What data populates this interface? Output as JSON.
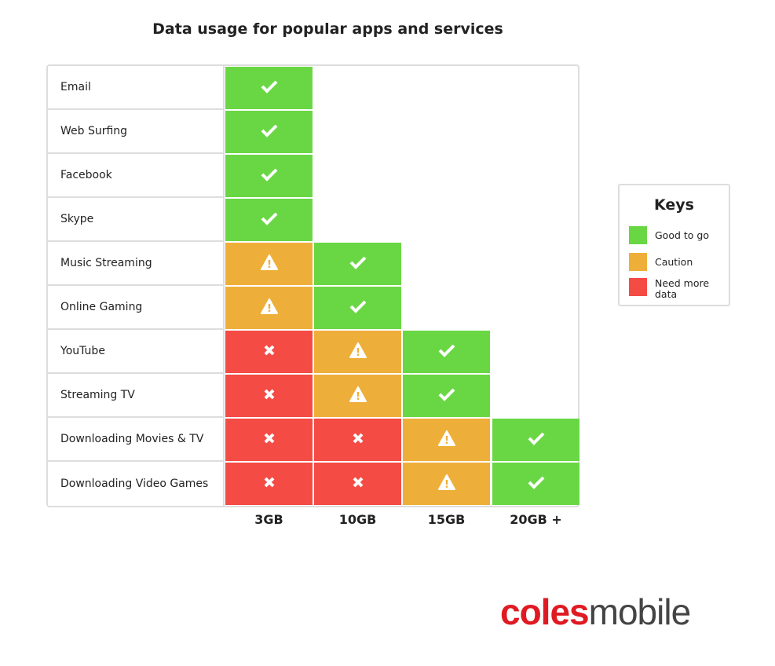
{
  "chart_data": {
    "type": "table",
    "title": "Data usage for popular apps and services",
    "columns": [
      "3GB",
      "10GB",
      "15GB",
      "20GB +"
    ],
    "rows": [
      {
        "label": "Email",
        "values": [
          "good",
          null,
          null,
          null
        ]
      },
      {
        "label": "Web Surfing",
        "values": [
          "good",
          null,
          null,
          null
        ]
      },
      {
        "label": "Facebook",
        "values": [
          "good",
          null,
          null,
          null
        ]
      },
      {
        "label": "Skype",
        "values": [
          "good",
          null,
          null,
          null
        ]
      },
      {
        "label": "Music Streaming",
        "values": [
          "caution",
          "good",
          null,
          null
        ]
      },
      {
        "label": "Online Gaming",
        "values": [
          "caution",
          "good",
          null,
          null
        ]
      },
      {
        "label": "YouTube",
        "values": [
          "more",
          "caution",
          "good",
          null
        ]
      },
      {
        "label": "Streaming TV",
        "values": [
          "more",
          "caution",
          "good",
          null
        ]
      },
      {
        "label": "Downloading Movies & TV",
        "values": [
          "more",
          "more",
          "caution",
          "good"
        ]
      },
      {
        "label": "Downloading Video Games",
        "values": [
          "more",
          "more",
          "caution",
          "good"
        ]
      }
    ],
    "legend": {
      "title": "Keys",
      "items": [
        {
          "key": "good",
          "label": "Good to go",
          "color": "#69d744",
          "icon": "check-icon"
        },
        {
          "key": "caution",
          "label": "Caution",
          "color": "#eeaf3a",
          "icon": "warning-icon"
        },
        {
          "key": "more",
          "label": "Need more data",
          "color": "#f44b45",
          "icon": "x-icon"
        }
      ]
    }
  },
  "logo": {
    "part1": "coles",
    "part2": "mobile",
    "color1": "#e01a22",
    "color2": "#444444"
  }
}
